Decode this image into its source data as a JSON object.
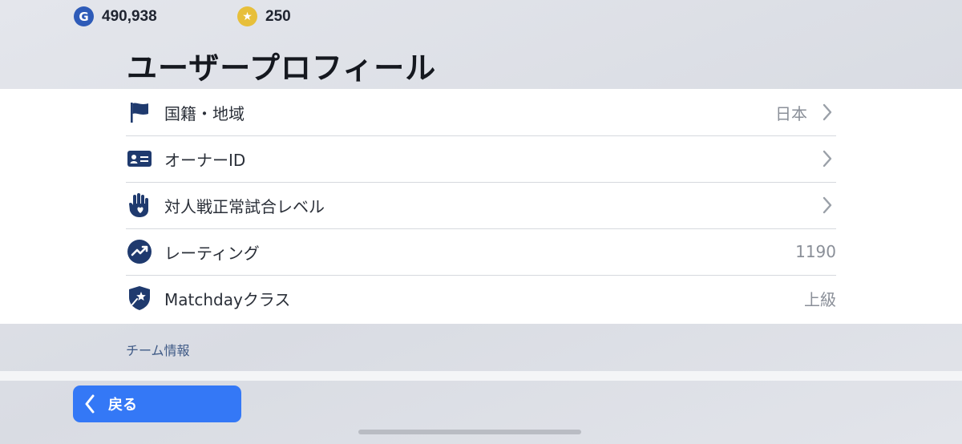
{
  "currency": {
    "gp_icon_letter": "G",
    "gp_value": "490,938",
    "coins_icon_glyph": "★",
    "coins_value": "250"
  },
  "page_title": "ユーザープロフィール",
  "profile_items": [
    {
      "label": "国籍・地域",
      "value": "日本",
      "icon": "flag-icon",
      "has_chevron": true
    },
    {
      "label": "オーナーID",
      "value": "",
      "icon": "id-card-icon",
      "has_chevron": true
    },
    {
      "label": "対人戦正常試合レベル",
      "value": "",
      "icon": "hand-heart-icon",
      "has_chevron": true
    },
    {
      "label": "レーティング",
      "value": "1190",
      "icon": "trend-chart-icon",
      "has_chevron": false
    },
    {
      "label": "Matchdayクラス",
      "value": "上級",
      "icon": "shield-star-icon",
      "has_chevron": false
    }
  ],
  "section_header": "チーム情報",
  "back_button": {
    "label": "戻る"
  },
  "colors": {
    "accent_blue": "#3478f6",
    "icon_navy": "#1f3a6e",
    "gp_blue": "#2e5bb8",
    "coin_gold": "#e7bf3a"
  }
}
